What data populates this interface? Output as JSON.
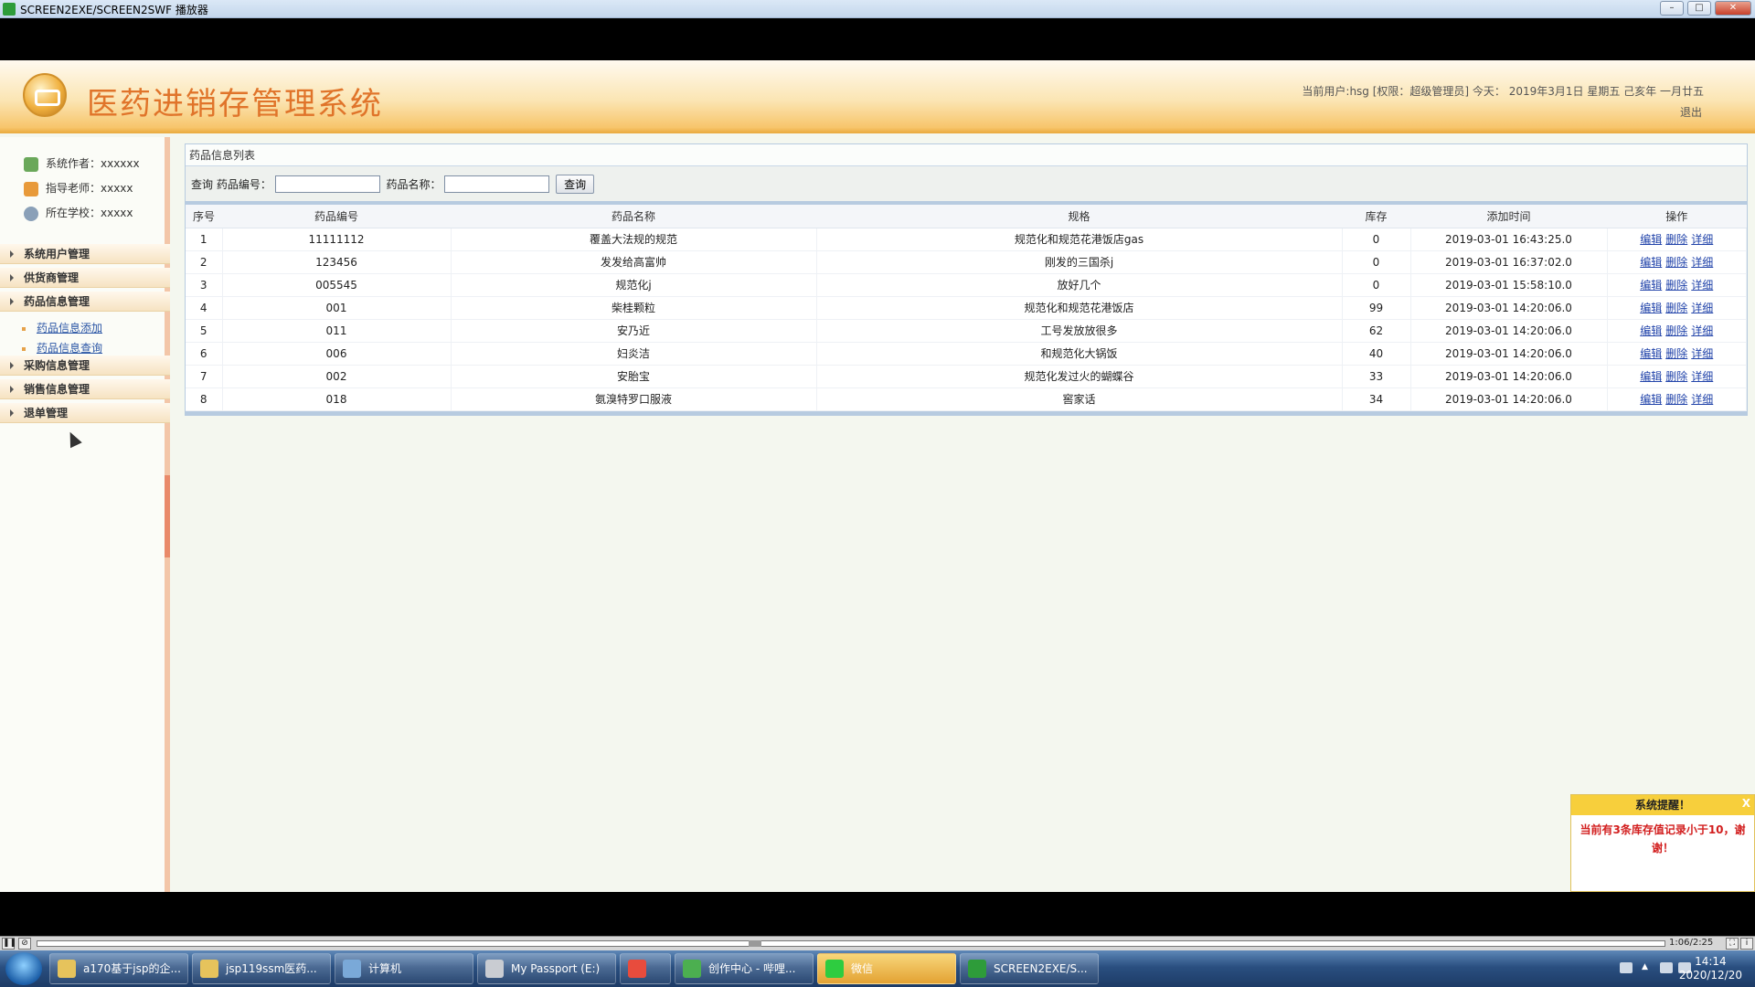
{
  "window": {
    "title": "SCREEN2EXE/SCREEN2SWF 播放器",
    "minimize": "–",
    "maximize": "□",
    "close": "✕"
  },
  "header": {
    "system_title": "医药进销存管理系统",
    "user_info": "当前用户:hsg [权限：超级管理员] 今天： 2019年3月1日 星期五 己亥年 一月廿五",
    "logout": "退出"
  },
  "sidebar": {
    "info": [
      {
        "label": "系统作者：xxxxxx",
        "icon": "author-icon"
      },
      {
        "label": "指导老师：xxxxx",
        "icon": "teacher-icon"
      },
      {
        "label": "所在学校：xxxxx",
        "icon": "school-icon"
      }
    ],
    "menu": [
      {
        "label": "系统用户管理"
      },
      {
        "label": "供货商管理"
      },
      {
        "label": "药品信息管理",
        "children": [
          {
            "label": "药品信息添加"
          },
          {
            "label": "药品信息查询"
          }
        ]
      },
      {
        "label": "采购信息管理"
      },
      {
        "label": "销售信息管理"
      },
      {
        "label": "退单管理"
      }
    ]
  },
  "main": {
    "panel_title": "药品信息列表",
    "search": {
      "prefix": "查询 药品编号：",
      "code_value": "",
      "name_label": "药品名称：",
      "name_value": "",
      "button": "查询"
    },
    "table": {
      "headers": [
        "序号",
        "药品编号",
        "药品名称",
        "规格",
        "库存",
        "添加时间",
        "操作"
      ],
      "rows": [
        {
          "no": "1",
          "code": "11111112",
          "name": "覆盖大法规的规范",
          "spec": "规范化和规范花港饭店gas",
          "stock": "0",
          "time": "2019-03-01 16:43:25.0"
        },
        {
          "no": "2",
          "code": "123456",
          "name": "发发给高富帅",
          "spec": "刚发的三国杀j",
          "stock": "0",
          "time": "2019-03-01 16:37:02.0"
        },
        {
          "no": "3",
          "code": "005545",
          "name": "规范化j",
          "spec": "放好几个",
          "stock": "0",
          "time": "2019-03-01 15:58:10.0"
        },
        {
          "no": "4",
          "code": "001",
          "name": "柴桂颗粒",
          "spec": "规范化和规范花港饭店",
          "stock": "99",
          "time": "2019-03-01 14:20:06.0"
        },
        {
          "no": "5",
          "code": "011",
          "name": "安乃近",
          "spec": "工号发放放很多",
          "stock": "62",
          "time": "2019-03-01 14:20:06.0"
        },
        {
          "no": "6",
          "code": "006",
          "name": "妇炎洁",
          "spec": "和规范化大锅饭",
          "stock": "40",
          "time": "2019-03-01 14:20:06.0"
        },
        {
          "no": "7",
          "code": "002",
          "name": "安胎宝",
          "spec": "规范化发过火的蝴蝶谷",
          "stock": "33",
          "time": "2019-03-01 14:20:06.0"
        },
        {
          "no": "8",
          "code": "018",
          "name": "氨溴特罗口服液",
          "spec": "窖家话",
          "stock": "34",
          "time": "2019-03-01 14:20:06.0"
        }
      ],
      "actions": [
        "编辑",
        "删除",
        "详细"
      ]
    }
  },
  "notice": {
    "title": "系统提醒！",
    "close": "X",
    "message": "当前有3条库存值记录小于10，谢谢！"
  },
  "player": {
    "time": "1:06/2:25",
    "progress": 0.44
  },
  "taskbar": {
    "items": [
      {
        "label": "a170基于jsp的企...",
        "icon": "folder-icon",
        "color": "#e6c35c"
      },
      {
        "label": "jsp119ssm医药...",
        "icon": "folder-icon",
        "color": "#e6c35c"
      },
      {
        "label": "计算机",
        "icon": "computer-icon",
        "color": "#7aa9d8"
      },
      {
        "label": "My Passport (E:)",
        "icon": "drive-icon",
        "color": "#c9ccd2"
      },
      {
        "label": "",
        "icon": "app-icon",
        "color": "#e84c3d"
      },
      {
        "label": "创作中心 - 哔哩...",
        "icon": "chrome-icon",
        "color": "#4caf50"
      },
      {
        "label": "微信",
        "icon": "wechat-icon",
        "color": "#2ecc40"
      },
      {
        "label": "SCREEN2EXE/S...",
        "icon": "screen2exe-icon",
        "color": "#2e9c3a"
      }
    ],
    "clock_time": "14:14",
    "clock_date": "2020/12/20"
  }
}
